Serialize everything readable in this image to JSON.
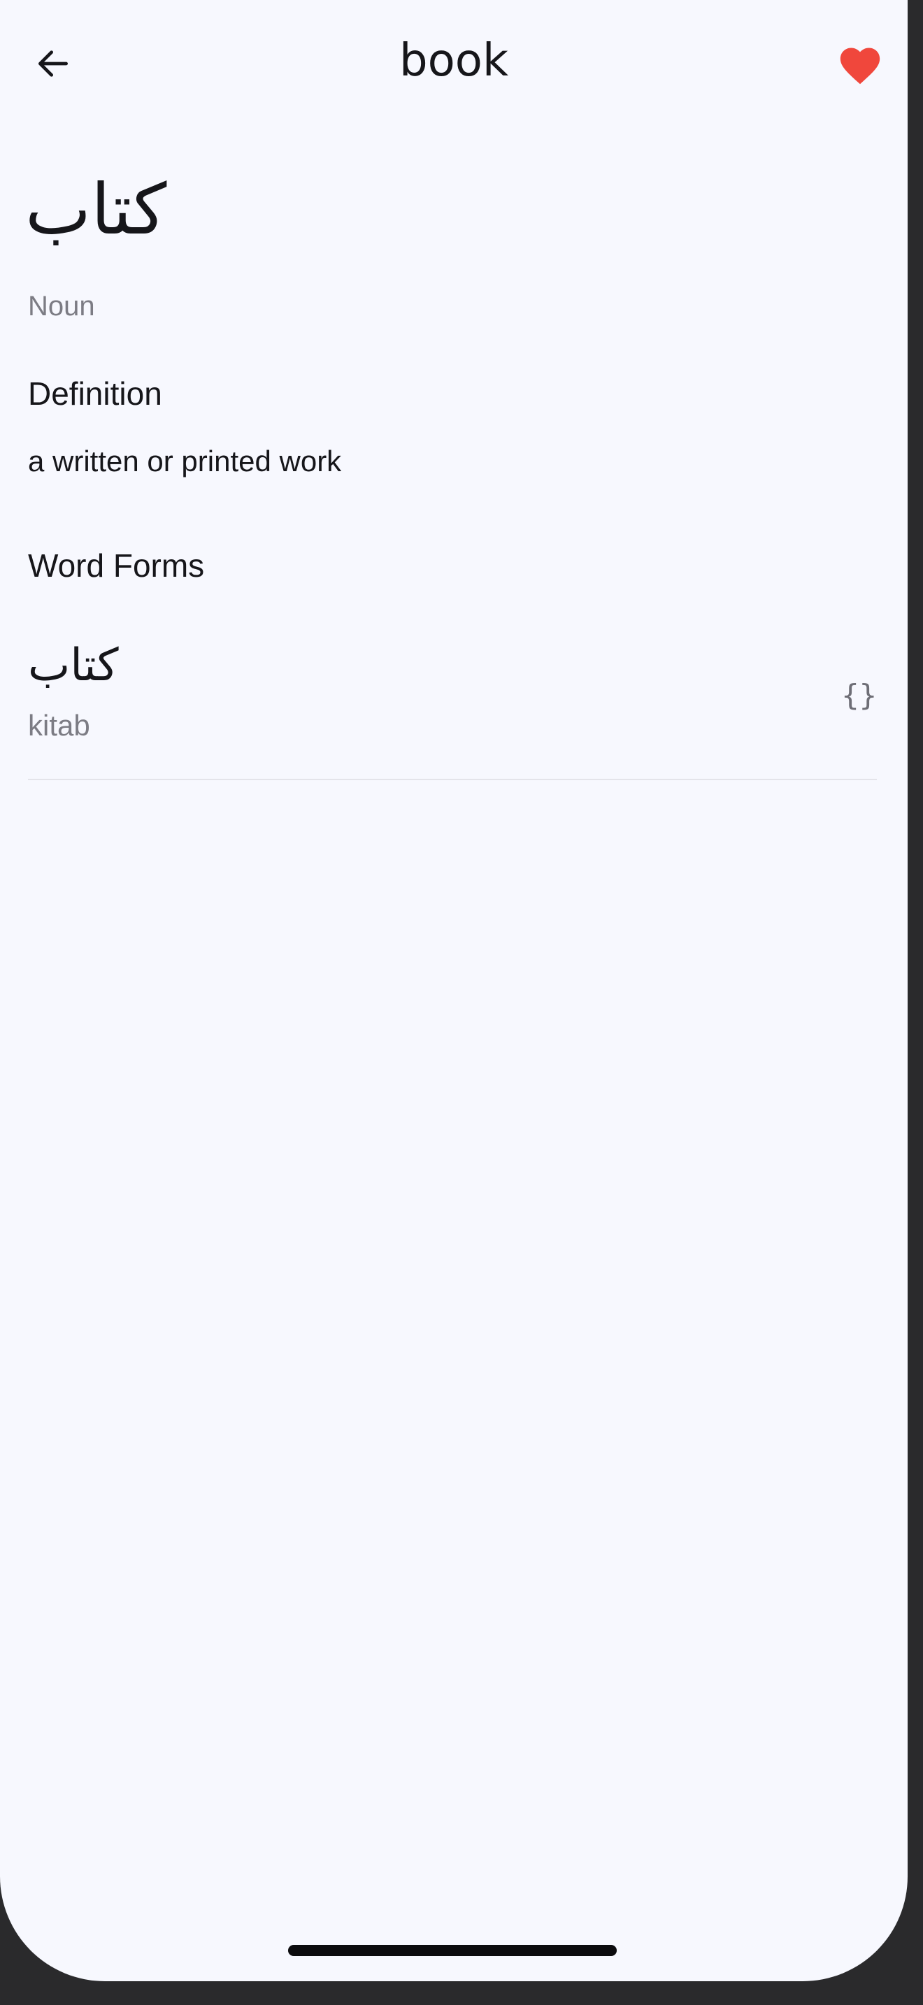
{
  "header": {
    "title": "book",
    "back_icon": "arrow-left-icon",
    "favorite_icon": "heart-filled-icon",
    "favorite_active": true
  },
  "entry": {
    "arabic": "كتاب",
    "part_of_speech": "Noun"
  },
  "definition": {
    "heading": "Definition",
    "text": "a written or printed work"
  },
  "word_forms": {
    "heading": "Word Forms",
    "items": [
      {
        "arabic": "كتاب",
        "transliteration": "kitab",
        "icon": "braces-icon",
        "icon_glyph": "{}"
      }
    ]
  },
  "colors": {
    "background": "#f7f8fe",
    "text_primary": "#16161a",
    "text_secondary": "#7c7c84",
    "favorite": "#f0473c",
    "divider": "#e4e4ea"
  }
}
